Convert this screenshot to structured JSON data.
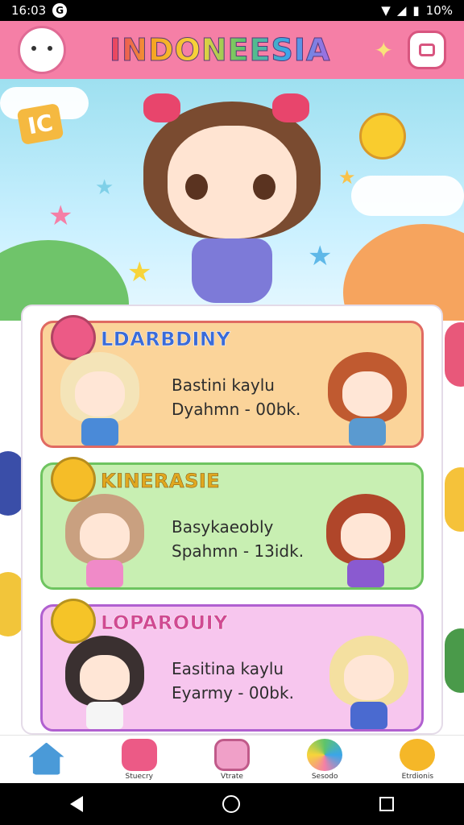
{
  "status_bar": {
    "time": "16:03",
    "battery": "10%"
  },
  "header": {
    "title": "INDONEESIA"
  },
  "cards": [
    {
      "title": "LDARBDINY",
      "line1": "Bastini kaylu",
      "line2": "Dyahmn - 00bk."
    },
    {
      "title": "KINERASIE",
      "line1": "Basykaeobly",
      "line2": "Spahmn - 13idk."
    },
    {
      "title": "LOPAROUIY",
      "line1": "Easitina kaylu",
      "line2": "Eyarmy - 00bk."
    }
  ],
  "bottom_nav": [
    {
      "label": "",
      "icon": "home-icon"
    },
    {
      "label": "Stuecry",
      "icon": "ribbon-icon"
    },
    {
      "label": "Vtrate",
      "icon": "tv-icon"
    },
    {
      "label": "Sesodo",
      "icon": "globe-icon"
    },
    {
      "label": "Etrdionis",
      "icon": "bear-icon"
    }
  ],
  "colors": {
    "header": "#f57fa6",
    "card1": "#fbd49a",
    "card2": "#c8efb2",
    "card3": "#f7c6ee"
  }
}
